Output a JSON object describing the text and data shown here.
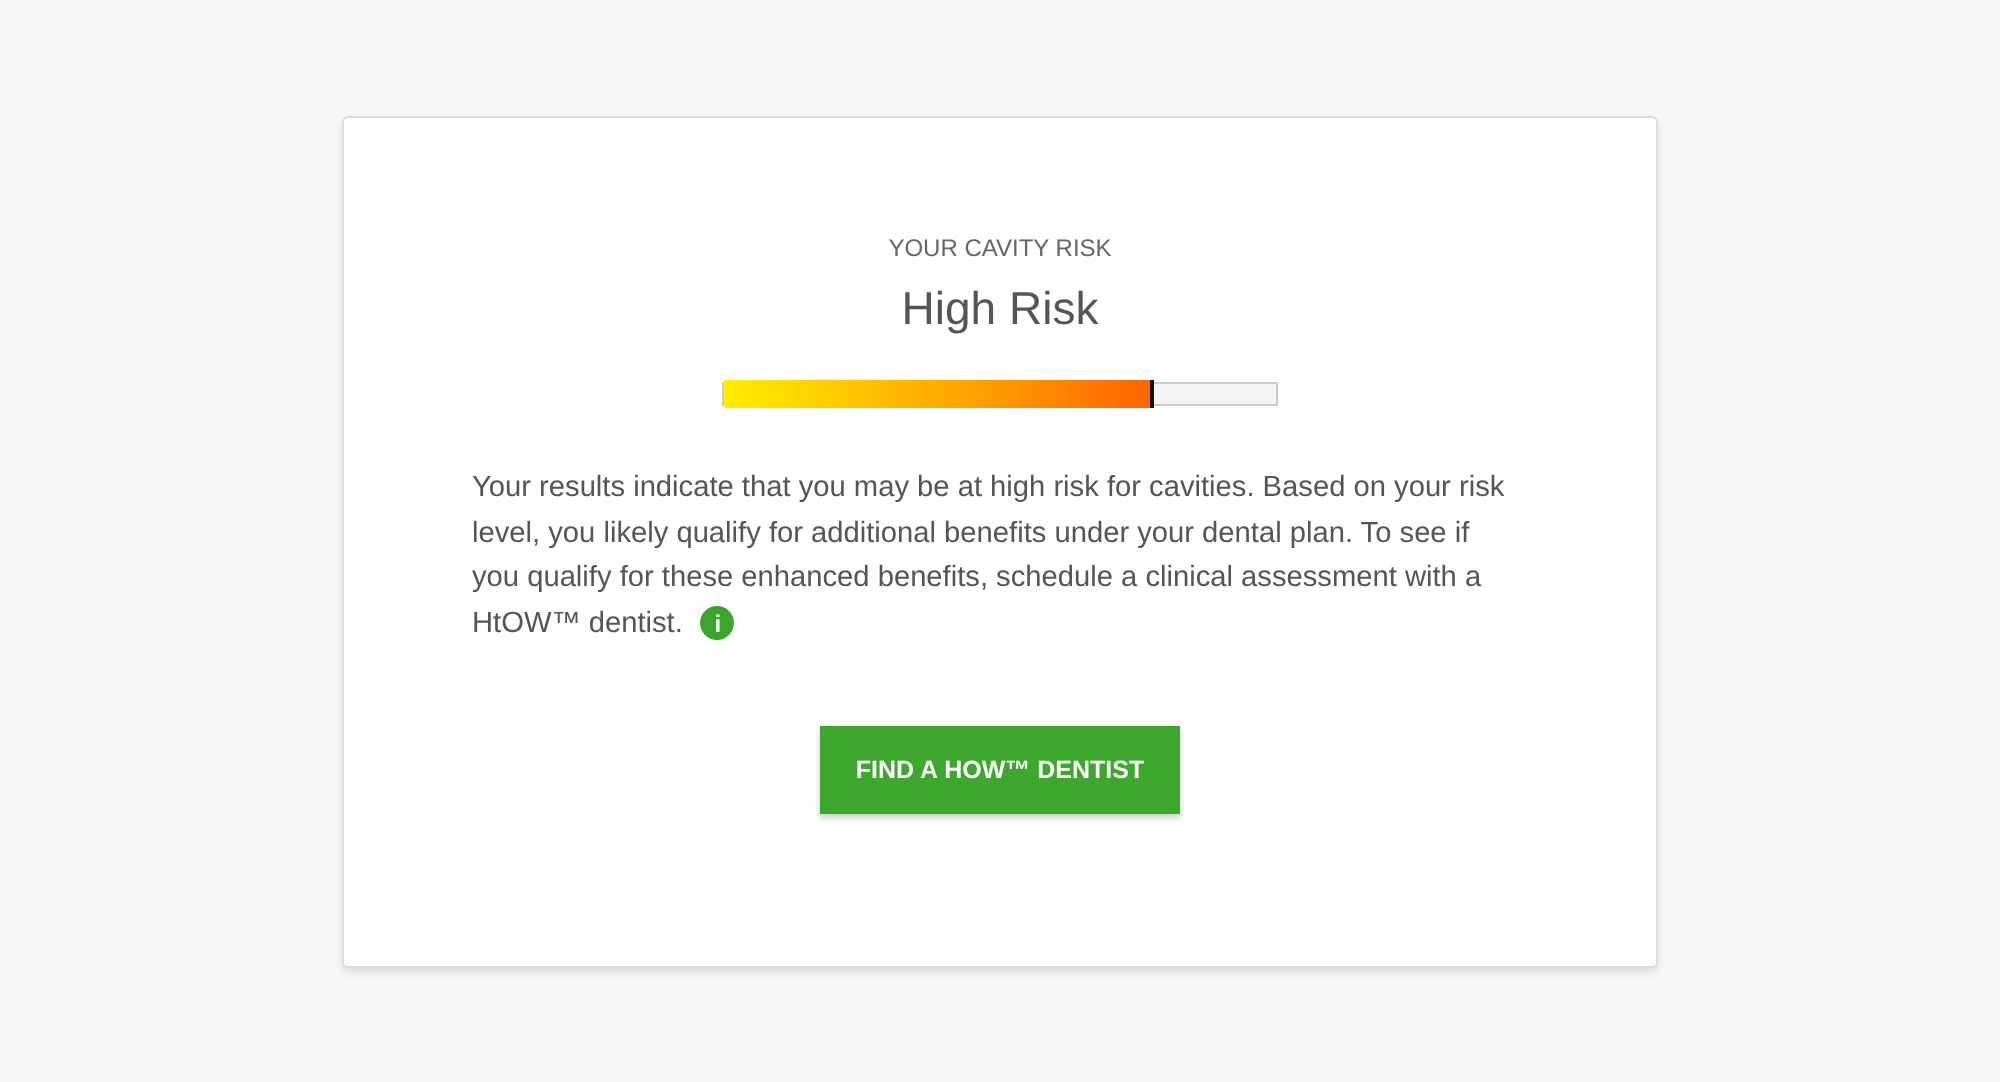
{
  "result": {
    "eyebrow": "YOUR CAVITY RISK",
    "title": "High Risk"
  },
  "meter": {
    "level": 0.78
  },
  "description": [
    "Your results indicate that you may be at high risk for cavities. Based on your risk level, you likely qualify for additional benefits under your dental plan. To see if you qualify for these enhanced benefits, schedule a clinical assessment with a",
    "HtOW™ dentist."
  ],
  "info_icon": "i",
  "button": {
    "label": "FIND A HOW™ DENTIST"
  }
}
